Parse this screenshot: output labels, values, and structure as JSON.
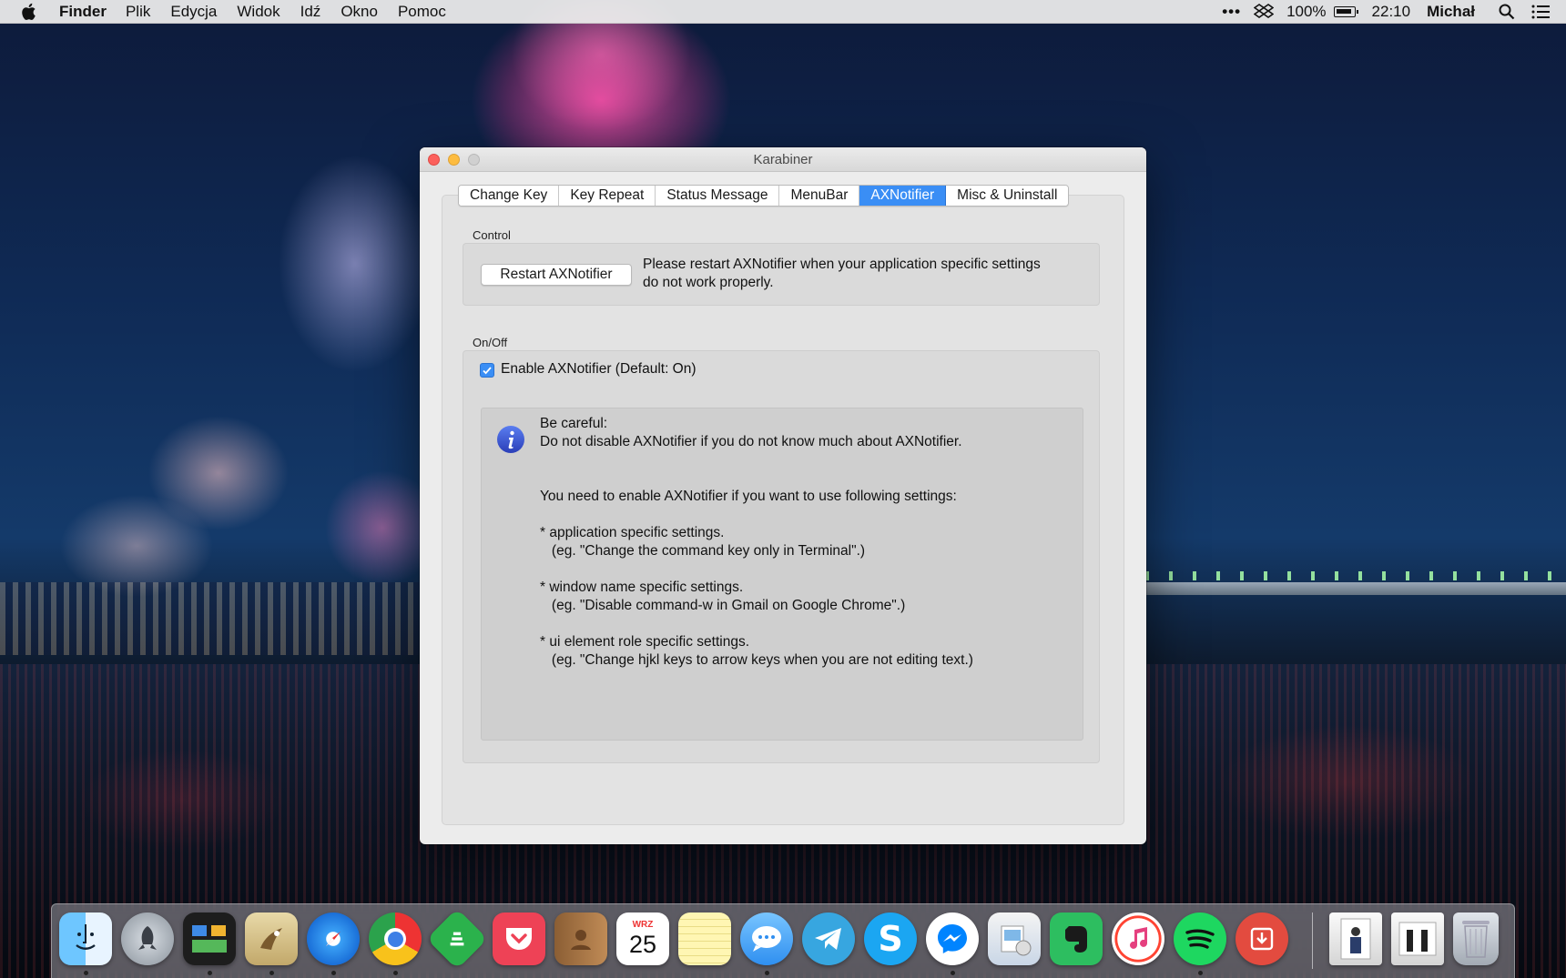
{
  "menubar": {
    "app_name": "Finder",
    "items": [
      "Plik",
      "Edycja",
      "Widok",
      "Idź",
      "Okno",
      "Pomoc"
    ],
    "battery_percent": "100%",
    "clock": "22:10",
    "user": "Michał"
  },
  "window": {
    "title": "Karabiner",
    "tabs": [
      {
        "label": "Change Key",
        "active": false
      },
      {
        "label": "Key Repeat",
        "active": false
      },
      {
        "label": "Status Message",
        "active": false
      },
      {
        "label": "MenuBar",
        "active": false
      },
      {
        "label": "AXNotifier",
        "active": true
      },
      {
        "label": "Misc & Uninstall",
        "active": false
      }
    ],
    "control": {
      "group_label": "Control",
      "restart_button": "Restart AXNotifier",
      "description_line1": "Please restart AXNotifier when your application specific settings",
      "description_line2": "do not work properly."
    },
    "onoff": {
      "group_label": "On/Off",
      "checkbox_label": "Enable AXNotifier (Default: On)",
      "checkbox_checked": true,
      "info": {
        "line1": "Be careful:",
        "line2": "Do not disable AXNotifier if you do not know much about AXNotifier.",
        "line3": "You need to enable AXNotifier if you want to use following settings:",
        "item1_title": "* application specific settings.",
        "item1_example": "   (eg. \"Change the command key only in Terminal\".)",
        "item2_title": "* window name specific settings.",
        "item2_example": "   (eg. \"Disable command-w in Gmail on Google Chrome\".)",
        "item3_title": "* ui element role specific settings.",
        "item3_example": "   (eg. \"Change hjkl keys to arrow keys when you are not editing text.)"
      }
    }
  },
  "dock": {
    "calendar_month": "WRZ",
    "calendar_day": "25",
    "items": [
      "finder-icon",
      "launchpad-icon",
      "mission-control-icon",
      "mail-icon",
      "safari-icon",
      "chrome-icon",
      "feedly-icon",
      "pocket-icon",
      "contacts-icon",
      "calendar-icon",
      "notes-icon",
      "messages-icon",
      "telegram-icon",
      "skype-icon",
      "messenger-icon",
      "preview-icon",
      "evernote-icon",
      "itunes-icon",
      "spotify-icon",
      "transmit-icon",
      "document-stack-icon",
      "document-stack-icon",
      "trash-icon"
    ]
  },
  "colors": {
    "accent": "#3a8ef5",
    "close": "#fc605c",
    "minimize": "#fdbc40",
    "window_bg": "#ececec"
  }
}
